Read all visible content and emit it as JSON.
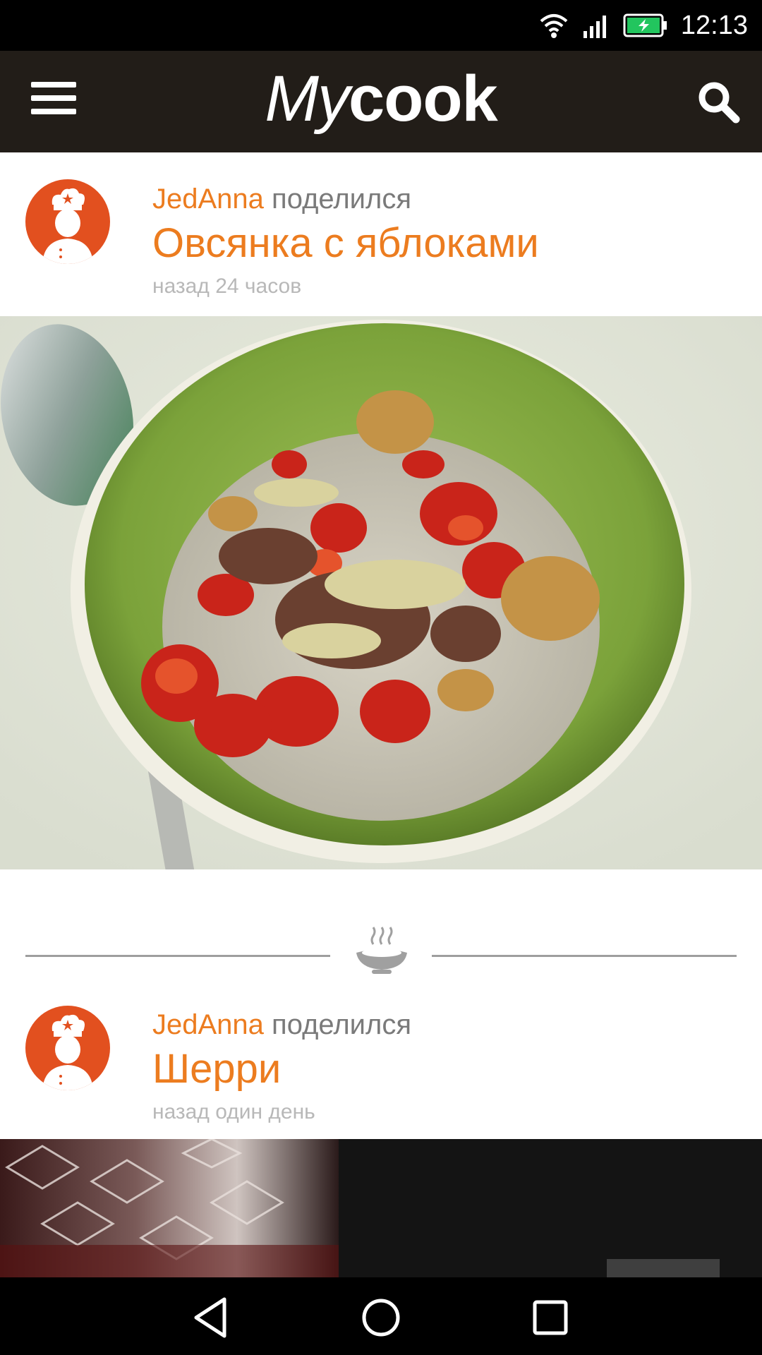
{
  "status_bar": {
    "time": "12:13",
    "icons": [
      "wifi-icon",
      "signal-icon",
      "battery-charging-icon"
    ]
  },
  "app_bar": {
    "logo_my": "My",
    "logo_cook": "cook",
    "menu_icon": "hamburger-menu-icon",
    "search_icon": "search-icon"
  },
  "feed": [
    {
      "user": "JedAnna",
      "action": "поделился",
      "title": "Овсянка с яблоками",
      "time": "назад 24 часов",
      "image": "oatmeal-bowl-photo"
    },
    {
      "user": "JedAnna",
      "action": "поделился",
      "title": "Шерри",
      "time": "назад один день",
      "image": "sherry-glass-photo"
    }
  ],
  "divider_icon": "steaming-plate-icon",
  "colors": {
    "accent": "#ec7c1f",
    "avatar_bg": "#e2501f",
    "app_bar": "#221d18",
    "meta_gray": "#b8b8b8"
  },
  "nav_bar": {
    "buttons": [
      "back-icon",
      "home-icon",
      "recents-icon"
    ]
  }
}
